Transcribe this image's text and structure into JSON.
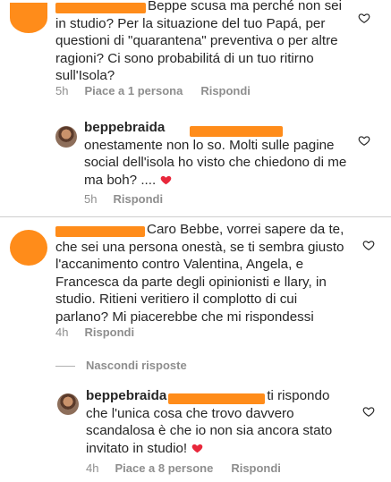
{
  "comment1": {
    "text": "Beppe scusa ma perché non sei in studio? Per la situazione del tuo Papá, per questioni di \"quarantena\" preventiva o per altre ragioni? Ci sono probabilitá di un tuo ritirno sull'Isola?",
    "time": "5h",
    "likes": "Piace a 1 persona",
    "reply": "Rispondi"
  },
  "reply1": {
    "username": "beppebraida",
    "text": "onestamente non lo so. Molti sulle pagine social dell'isola ho visto  che chiedono di me ma boh? ....",
    "time": "5h",
    "reply": "Rispondi"
  },
  "comment2": {
    "text": "Caro Bebbe, vorrei sapere da te, che sei una persona onestà, se ti sembra giusto l'accanimento contro Valentina, Angela, e Francesca da parte degli opinionisti e llary, in studio. Ritieni veritiero il complotto di cui parlano? Mi piacerebbe che mi rispondessi",
    "time": "4h",
    "reply": "Rispondi",
    "hide_replies": "Nascondi risposte"
  },
  "reply2": {
    "username": "beppebraida",
    "text": "ti rispondo che l'unica cosa che trovo davvero scandalosa è che io non sia ancora stato invitato in studio!",
    "time": "4h",
    "likes": "Piace a 8 persone",
    "reply": "Rispondi"
  },
  "colors": {
    "accent_redaction": "#ff8c1a",
    "heart": "#e8283b",
    "meta": "#8e8e8e"
  }
}
